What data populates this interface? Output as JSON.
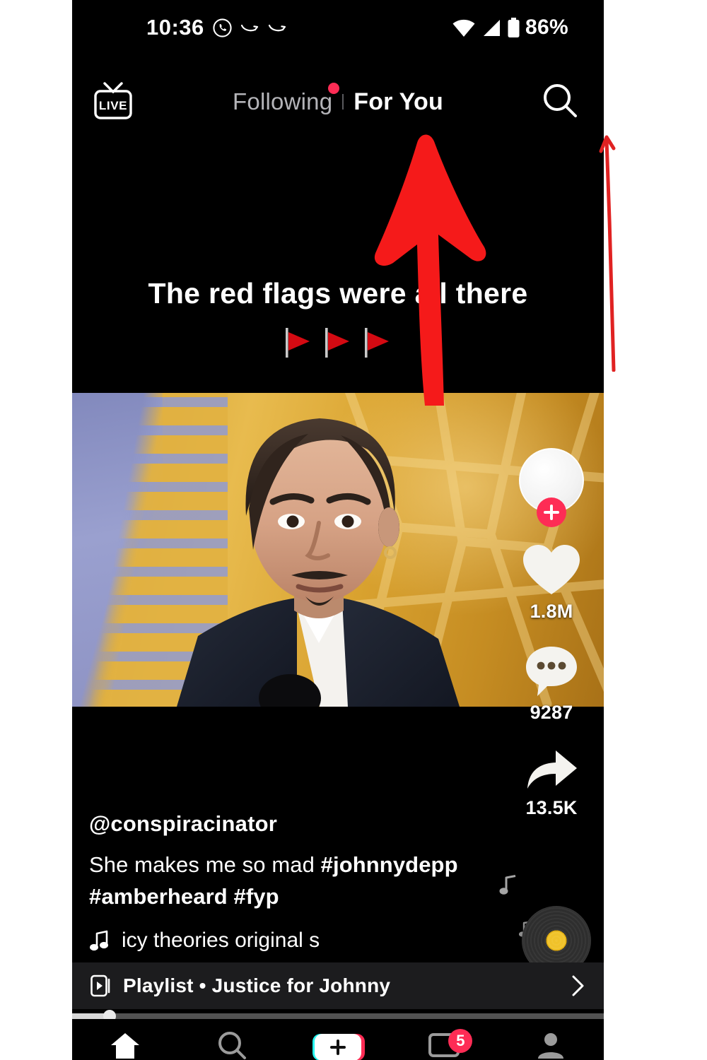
{
  "status_bar": {
    "time": "10:36",
    "battery_percent": "86%",
    "icons": [
      "whatsapp-icon",
      "curved-arrow-icon",
      "curved-arrow-icon",
      "wifi-icon",
      "cellular-signal-icon",
      "battery-icon"
    ]
  },
  "top_nav": {
    "live_label": "LIVE",
    "tabs": [
      {
        "label": "Following",
        "active": false,
        "has_dot": true
      },
      {
        "label": "For You",
        "active": true,
        "has_dot": false
      }
    ],
    "search_icon": "search-icon"
  },
  "video": {
    "caption_overlay": "The red flags were all there",
    "flag_emoji_count": 3,
    "flag_color": "#d40a12"
  },
  "actions": {
    "avatar_follow_label": "+",
    "like": {
      "icon": "heart-icon",
      "count": "1.8M"
    },
    "comment": {
      "icon": "comment-bubble-icon",
      "count": "9287"
    },
    "share": {
      "icon": "share-arrow-icon",
      "count": "13.5K"
    }
  },
  "post": {
    "username": "@conspiracinator",
    "caption_plain": "She makes me so mad ",
    "hashtag_1": "#johnnydepp",
    "hashtag_2": "#amberheard",
    "hashtag_3": "#fyp",
    "music_ticker": "icy theories   original s"
  },
  "playlist": {
    "icon": "playlist-icon",
    "label": "Playlist • Justice for Johnny",
    "chevron": "chevron-right-icon"
  },
  "progress": {
    "percent": 7
  },
  "bottom_nav": {
    "items": [
      "home-icon",
      "discover-icon",
      "create-icon",
      "inbox-icon",
      "profile-icon"
    ],
    "inbox_badge": "5"
  },
  "annotations": {
    "arrow_color": "#f51a1a",
    "line_color": "#e02222",
    "arrow_points_to": "For You"
  },
  "colors": {
    "accent_pink": "#fe2c55",
    "background": "#000000",
    "page_background": "#ffffff"
  }
}
